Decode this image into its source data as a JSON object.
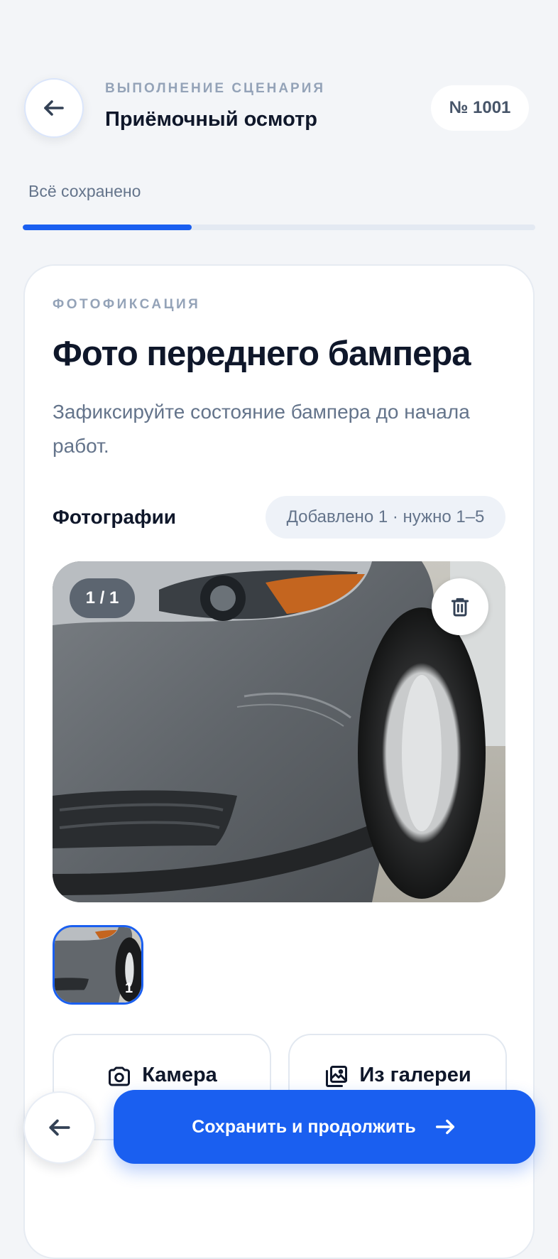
{
  "header": {
    "eyebrow": "ВЫПОЛНЕНИЕ СЦЕНАРИЯ",
    "title": "Приёмочный осмотр",
    "order_number": "№ 1001"
  },
  "status": {
    "saved_text": "Всё сохранено",
    "progress_fraction": 0.33
  },
  "step": {
    "section": "ФОТОФИКСАЦИЯ",
    "title": "Фото переднего бампера",
    "description": "Зафиксируйте состояние бампера до начала работ."
  },
  "photos": {
    "label": "Фотографии",
    "count_text": "Добавлено 1 · нужно 1–5",
    "counter": "1 / 1",
    "thumb_index": "1"
  },
  "actions": {
    "camera_label": "Камера",
    "gallery_label": "Из галереи",
    "save_label": "Сохранить и продолжить"
  },
  "colors": {
    "accent": "#1a5ff0",
    "background": "#f3f5f8"
  },
  "icons": [
    "arrow-left-icon",
    "trash-icon",
    "camera-icon",
    "gallery-icon",
    "arrow-right-icon"
  ]
}
